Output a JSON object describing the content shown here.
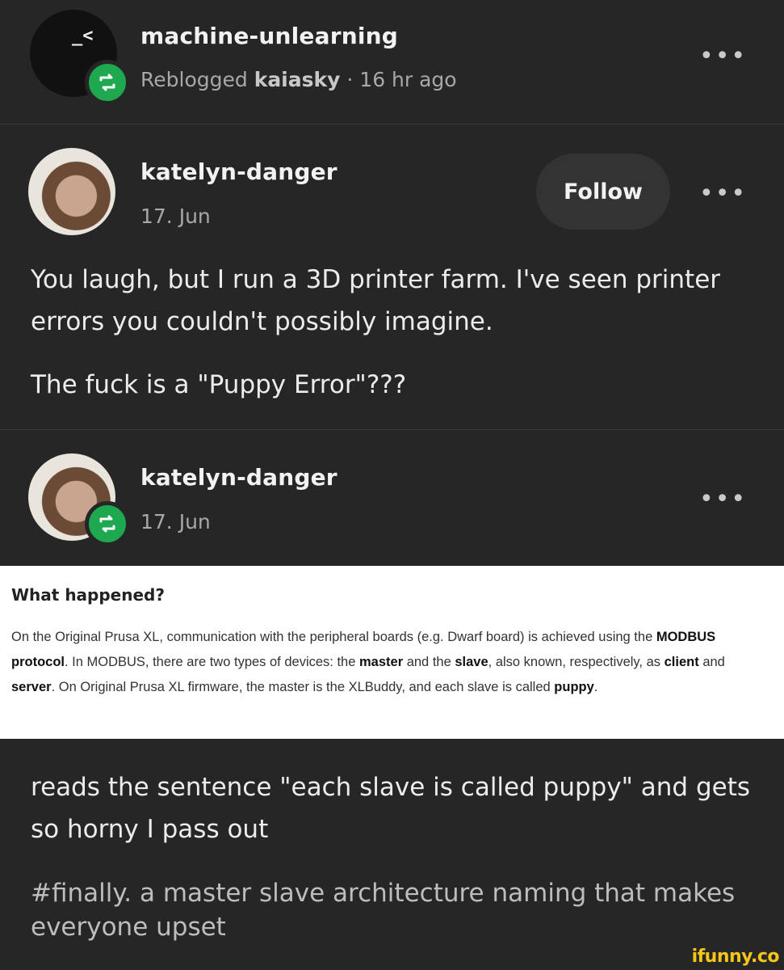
{
  "reblogger": {
    "avatar_text": "_<",
    "name": "machine-unlearning",
    "reblogged_prefix": "Reblogged",
    "reblogged_from": "kaiasky",
    "time": "· 16 hr ago"
  },
  "post1": {
    "author": "katelyn-danger",
    "date": "17. Jun",
    "follow_label": "Follow",
    "paragraphs": [
      "You laugh, but I run a 3D printer farm. I've seen printer errors you couldn't possibly imagine.",
      "The fuck is a \"Puppy Error\"???"
    ]
  },
  "post2": {
    "author": "katelyn-danger",
    "date": "17. Jun"
  },
  "screenshot_panel": {
    "title": "What happened?",
    "text": [
      "On the Original Prusa XL, communication with the peripheral boards (e.g. Dwarf board) is achieved using the ",
      "MODBUS protocol",
      ". In MODBUS, there are two types of devices: the ",
      "master",
      " and the ",
      "slave",
      ", also known, respectively, as ",
      "client",
      " and ",
      "server",
      ". On Original Prusa XL firmware, the master is the XLBuddy, and each slave is called ",
      "puppy",
      "."
    ]
  },
  "reply": {
    "text": "reads the sentence \"each slave is called puppy\" and gets so horny I pass out",
    "tags": "#finally. a master slave architecture naming that makes everyone upset"
  },
  "more_label": "•••",
  "watermark": "ifunny.co",
  "colors": {
    "reblog_green": "#1ea850",
    "background": "#262626",
    "watermark": "#f5c518"
  }
}
